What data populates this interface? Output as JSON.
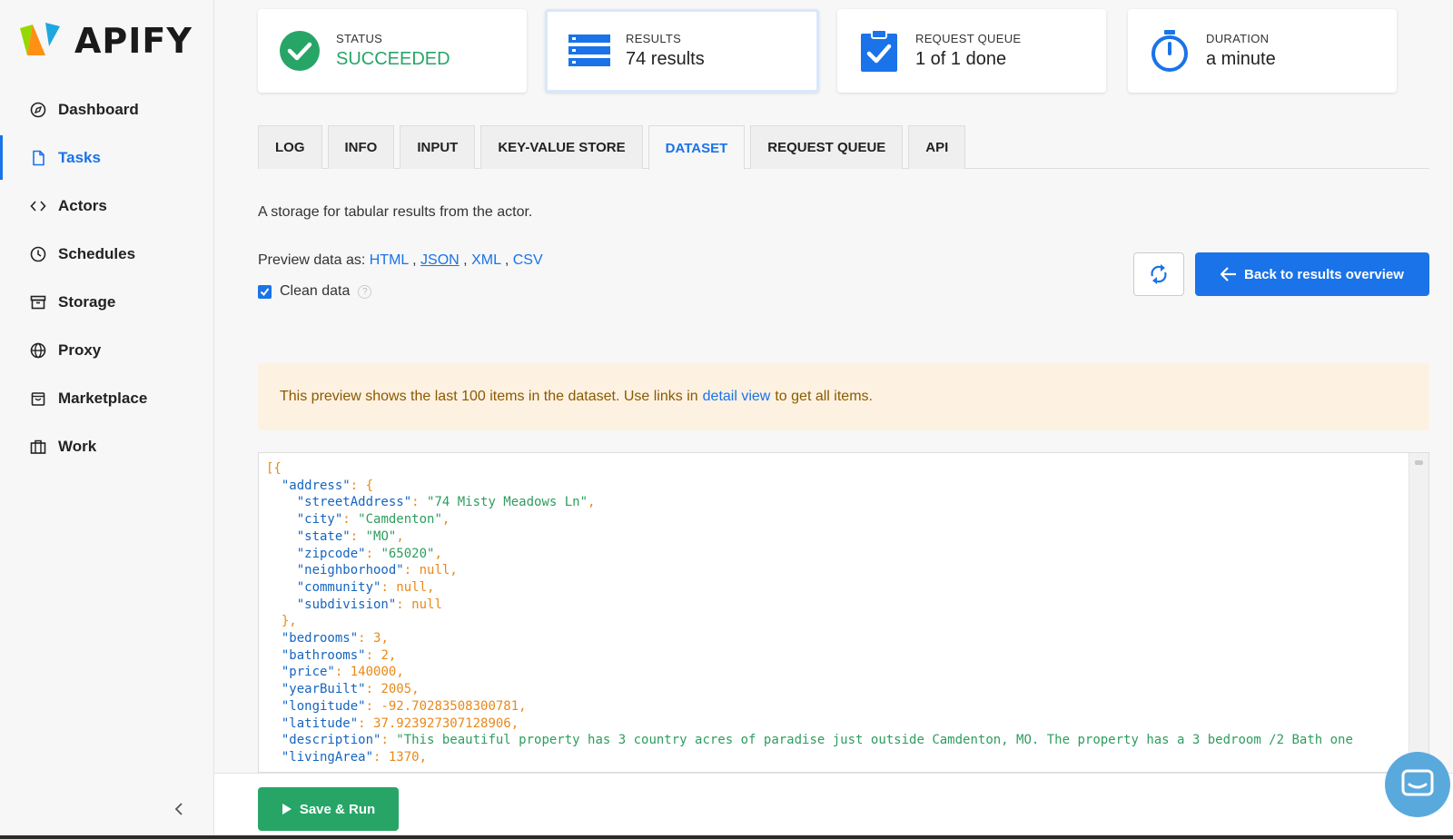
{
  "brand": {
    "name": "APIFY"
  },
  "sidebar": {
    "items": [
      {
        "label": "Dashboard",
        "icon": "compass-icon",
        "active": false
      },
      {
        "label": "Tasks",
        "icon": "file-icon",
        "active": true
      },
      {
        "label": "Actors",
        "icon": "code-icon",
        "active": false
      },
      {
        "label": "Schedules",
        "icon": "clock-icon",
        "active": false
      },
      {
        "label": "Storage",
        "icon": "archive-icon",
        "active": false
      },
      {
        "label": "Proxy",
        "icon": "globe-icon",
        "active": false
      },
      {
        "label": "Marketplace",
        "icon": "shopping-bag-icon",
        "active": false
      },
      {
        "label": "Work",
        "icon": "briefcase-icon",
        "active": false
      }
    ]
  },
  "stats": {
    "status": {
      "label": "STATUS",
      "value": "SUCCEEDED"
    },
    "results": {
      "label": "RESULTS",
      "value": "74 results"
    },
    "queue": {
      "label": "REQUEST QUEUE",
      "value": "1 of 1 done"
    },
    "duration": {
      "label": "DURATION",
      "value": "a minute"
    }
  },
  "tabs": [
    "LOG",
    "INFO",
    "INPUT",
    "KEY-VALUE STORE",
    "DATASET",
    "REQUEST QUEUE",
    "API"
  ],
  "active_tab": "DATASET",
  "dataset": {
    "description": "A storage for tabular results from the actor.",
    "preview_label": "Preview data as:",
    "formats": [
      "HTML",
      "JSON",
      "XML",
      "CSV"
    ],
    "selected_format": "JSON",
    "clean_data_label": "Clean data",
    "clean_data_checked": true,
    "refresh_icon": "refresh-icon",
    "back_label": "Back to results overview",
    "alert_prefix": "This preview shows the last 100 items in the dataset. Use links in",
    "alert_link": "detail view",
    "alert_suffix": "to get all items."
  },
  "json_preview": {
    "streetAddress": "74 Misty Meadows Ln",
    "city": "Camdenton",
    "state": "MO",
    "zipcode": "65020",
    "neighborhood": "null",
    "community": "null",
    "subdivision": "null",
    "bedrooms": "3",
    "bathrooms": "2",
    "price": "140000",
    "yearBuilt": "2005",
    "longitude": "-92.70283508300781",
    "latitude": "37.923927307128906",
    "description": "This beautiful property has 3 country acres of paradise just outside Camdenton, MO. The property has a 3 bedroom /2 Bath one",
    "livingArea": "1370"
  },
  "footer": {
    "save_label": "Save & Run"
  },
  "colors": {
    "accent": "#1a73e8",
    "success": "#27a567",
    "alert_bg": "#fdf1e1"
  }
}
